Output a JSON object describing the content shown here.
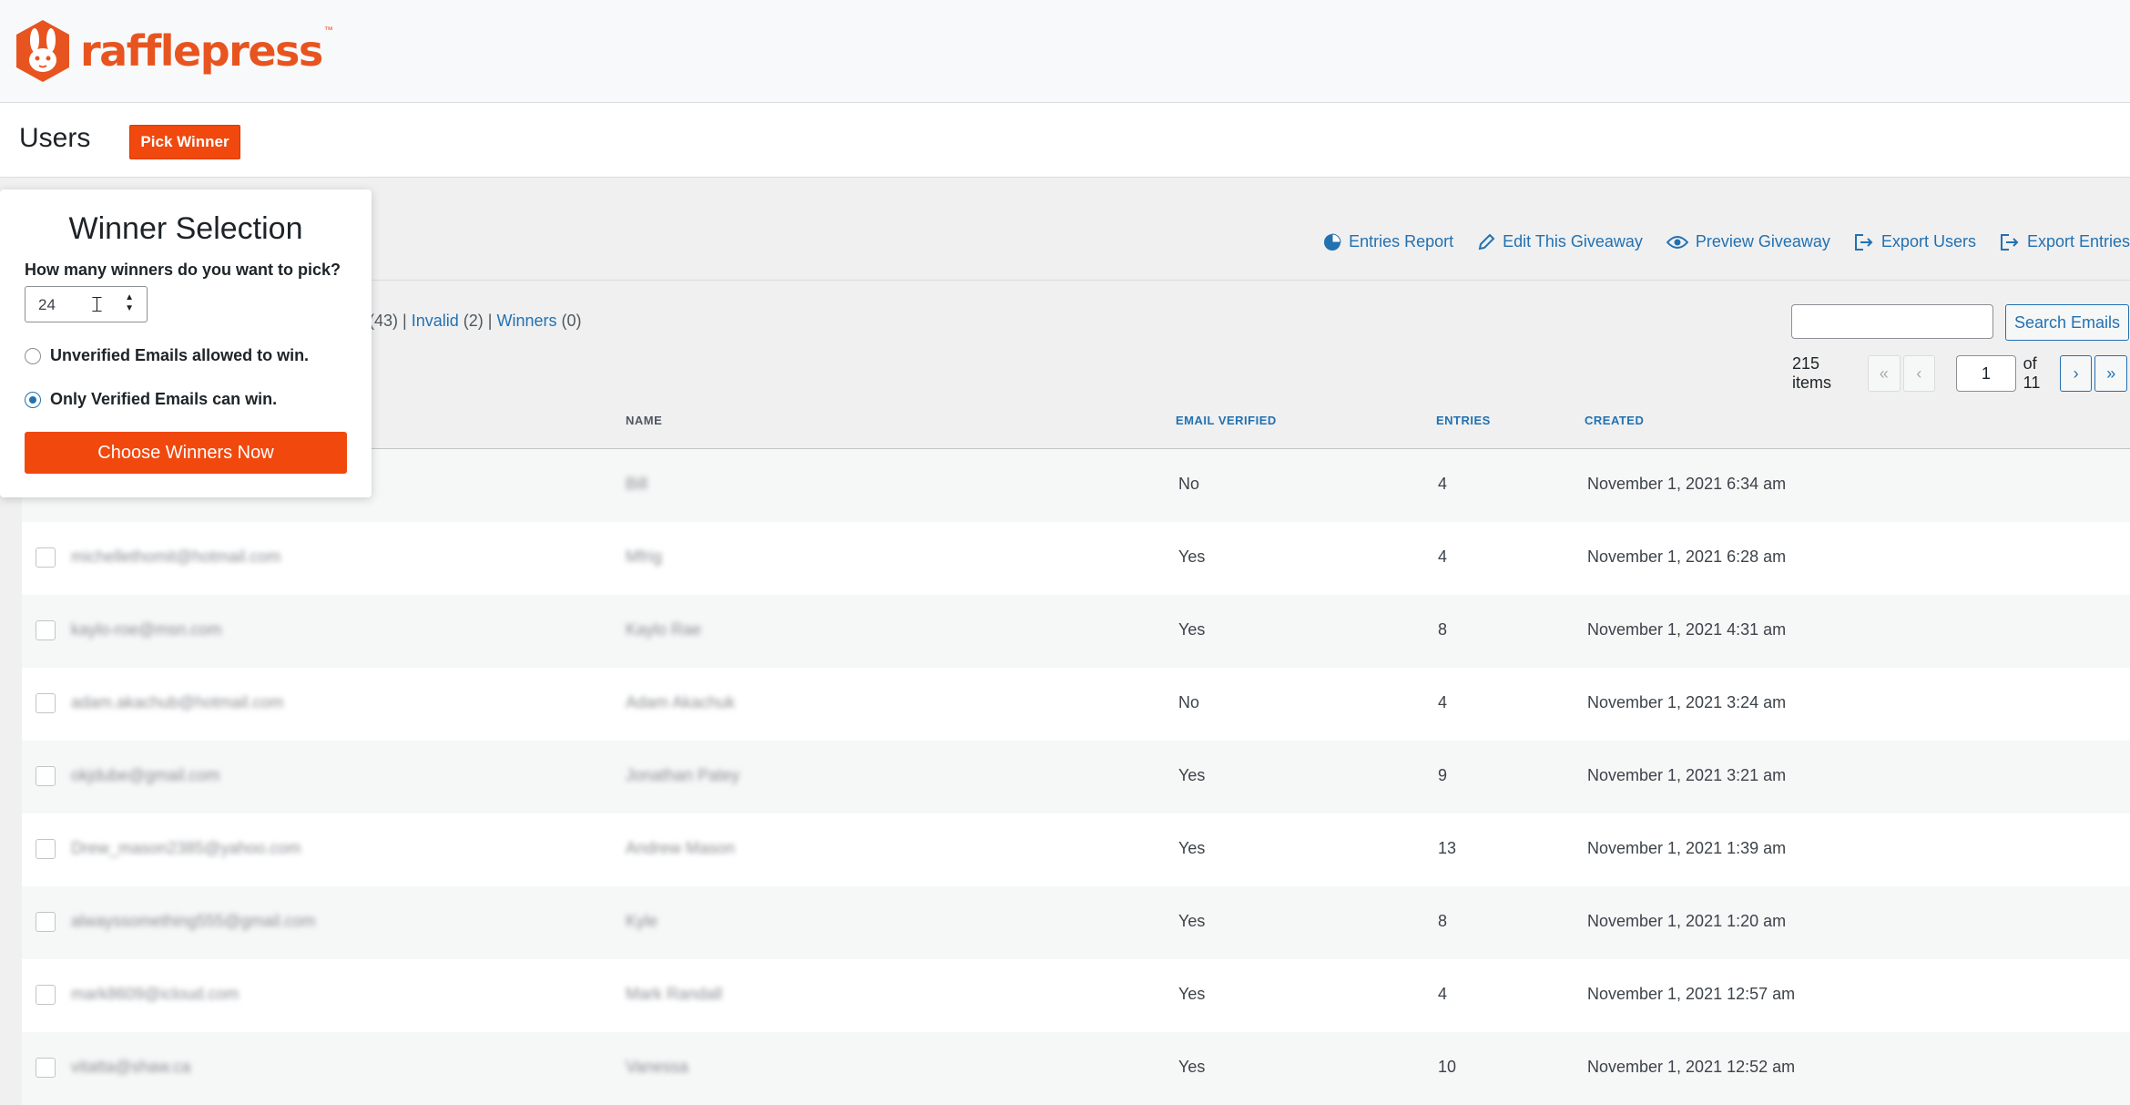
{
  "brand": {
    "name": "rafflepress",
    "tm": "™",
    "color": "#e8541f"
  },
  "header": {
    "title": "Users",
    "pick_winner": "Pick Winner"
  },
  "actions": [
    {
      "label": "Entries Report",
      "icon": "pie-chart-icon"
    },
    {
      "label": "Edit This Giveaway",
      "icon": "pencil-icon"
    },
    {
      "label": "Preview Giveaway",
      "icon": "eye-icon"
    },
    {
      "label": "Export Users",
      "icon": "export-icon"
    },
    {
      "label": "Export Entries",
      "icon": "export-icon"
    }
  ],
  "filters": {
    "count_a": "(43)",
    "invalid": "Invalid",
    "invalid_count": "(2)",
    "winners": "Winners",
    "winners_count": "(0)"
  },
  "search": {
    "button": "Search Emails",
    "value": ""
  },
  "pagination": {
    "items": "215 items",
    "first": "«",
    "prev": "‹",
    "current": "1",
    "of": "of 11",
    "next": "›",
    "last": "»"
  },
  "table": {
    "columns": {
      "name": "NAME",
      "email_verified": "EMAIL VERIFIED",
      "entries": "ENTRIES",
      "created": "CREATED"
    },
    "rows": [
      {
        "email": "",
        "name": "Bill",
        "verified": "No",
        "entries": "4",
        "created": "November 1, 2021 6:34 am"
      },
      {
        "email": "michellethomit@hotmail.com",
        "name": "Mfrig",
        "verified": "Yes",
        "entries": "4",
        "created": "November 1, 2021 6:28 am"
      },
      {
        "email": "kaylo-roe@msn.com",
        "name": "Kaylo Rae",
        "verified": "Yes",
        "entries": "8",
        "created": "November 1, 2021 4:31 am"
      },
      {
        "email": "adam.akachub@hotmail.com",
        "name": "Adam Akachuk",
        "verified": "No",
        "entries": "4",
        "created": "November 1, 2021 3:24 am"
      },
      {
        "email": "okjdube@gmail.com",
        "name": "Jonathan Patey",
        "verified": "Yes",
        "entries": "9",
        "created": "November 1, 2021 3:21 am"
      },
      {
        "email": "Drew_mason2385@yahoo.com",
        "name": "Andrew Mason",
        "verified": "Yes",
        "entries": "13",
        "created": "November 1, 2021 1:39 am"
      },
      {
        "email": "alwayssomething555@gmail.com",
        "name": "Kyle",
        "verified": "Yes",
        "entries": "8",
        "created": "November 1, 2021 1:20 am"
      },
      {
        "email": "mark8609@icloud.com",
        "name": "Mark Randall",
        "verified": "Yes",
        "entries": "4",
        "created": "November 1, 2021 12:57 am"
      },
      {
        "email": "vitatta@shaw.ca",
        "name": "Vanessa",
        "verified": "Yes",
        "entries": "10",
        "created": "November 1, 2021 12:52 am"
      }
    ]
  },
  "popup": {
    "title": "Winner Selection",
    "question": "How many winners do you want to pick?",
    "count": "24",
    "option_unverified": "Unverified Emails allowed to win.",
    "option_verified": "Only Verified Emails can win.",
    "selected_option": "option_verified",
    "choose_button": "Choose Winners Now"
  }
}
